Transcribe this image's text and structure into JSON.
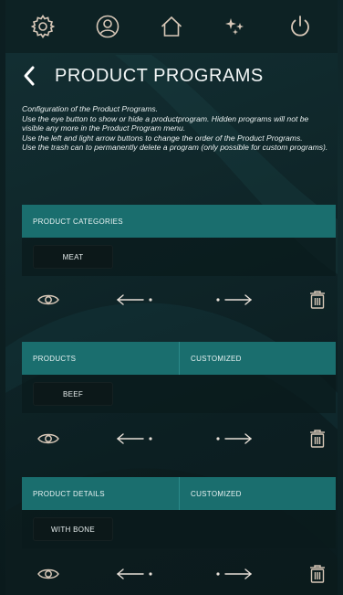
{
  "colors": {
    "accent": "#1a6e6e",
    "icon": "#d8c8b8",
    "background": "#0f2629",
    "chip": "#0c1819"
  },
  "topbar": {
    "icons": [
      "gear-icon",
      "user-icon",
      "home-icon",
      "sparkle-icon",
      "power-icon"
    ]
  },
  "header": {
    "title": "PRODUCT PROGRAMS"
  },
  "description": [
    "Configuration of the Product Programs.",
    "Use the eye button to show or hide a productprogram. Hidden programs will not be visible any more in the Product Program menu.",
    "Use the left and light arrow buttons to change the order of the Product Programs.",
    "Use the trash can to permanently delete a program (only possible for custom programs)."
  ],
  "sections": [
    {
      "headers": [
        "PRODUCT CATEGORIES"
      ],
      "item": "MEAT"
    },
    {
      "headers": [
        "PRODUCTS",
        "CUSTOMIZED"
      ],
      "item": "BEEF"
    },
    {
      "headers": [
        "PRODUCT DETAILS",
        "CUSTOMIZED"
      ],
      "item": "WITH BONE"
    }
  ],
  "actions": {
    "icons": [
      "eye-icon",
      "arrow-left-icon",
      "arrow-right-icon",
      "trash-icon"
    ]
  }
}
